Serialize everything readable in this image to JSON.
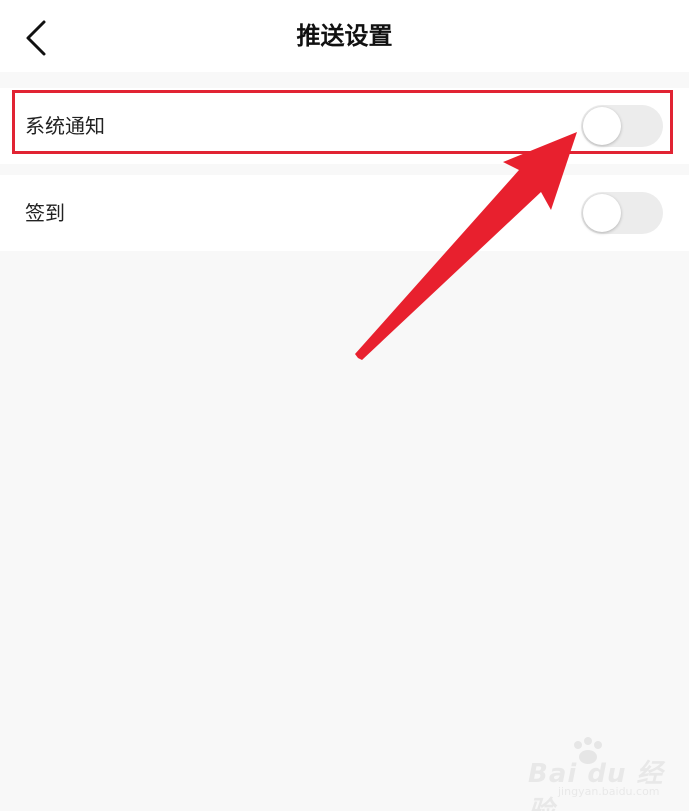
{
  "header": {
    "title": "推送设置",
    "back_icon": "chevron-left-icon"
  },
  "settings": [
    {
      "label": "系统通知",
      "enabled": false
    },
    {
      "label": "签到",
      "enabled": false
    }
  ],
  "annotation": {
    "highlight_color": "#e12333",
    "arrow_color": "#e8202e"
  },
  "watermark": {
    "text": "Bai du 经验",
    "sub": "jingyan.baidu.com"
  }
}
